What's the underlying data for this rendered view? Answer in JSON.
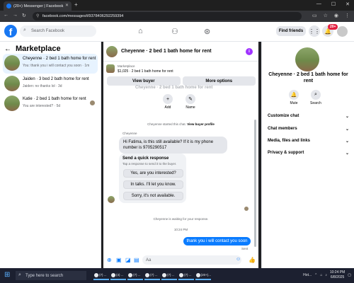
{
  "browser": {
    "tab_title": "(20+) Messenger | Facebook",
    "url": "facebook.com/messages/t/9378406292259394"
  },
  "header": {
    "search_placeholder": "Search Facebook",
    "find_friends": "Find friends",
    "notification_badge": "20+"
  },
  "left": {
    "title": "Marketplace",
    "conversations": [
      {
        "title": "Cheyenne · 2 bed 1 bath home for rent",
        "preview": "You: thank you i will contact you soon · 1m"
      },
      {
        "title": "Jaiden · 3 bed 2 bath home for rent",
        "preview": "Jaiden: no thanks lol · 3d"
      },
      {
        "title": "Katie · 2 bed 1 bath home for rent",
        "preview": "You are interested? · 5d"
      }
    ]
  },
  "chat": {
    "title": "Cheyenne · 2 bed 1 bath home for rent",
    "marketplace_label": "Marketplace",
    "listing": "$1,025 · 2 bed 1 bath home for rent",
    "view_buyer": "View buyer",
    "more_options": "More options",
    "ghost_title": "Cheyenne · 2 bed 1 bath home for rent",
    "add_label": "Add",
    "name_label": "Name",
    "started_text": "Cheyenne started this chat.",
    "view_profile": "View buyer profile",
    "sender_name": "Cheyenne",
    "incoming_message": "Hi Fatima, is this still available? If it is my phone number is 9705290517",
    "quick_header": "Send a quick response",
    "quick_sub": "Tap a response to send it to the buyer.",
    "quick_responses": [
      "Yes, are you interested?",
      "In talks. I'll let you know.",
      "Sorry, it's not available."
    ],
    "waiting_text": "Cheyenne is waiting for your response.",
    "timestamp": "10:24 PM",
    "outgoing_message": "thank you i will contact you soon",
    "sent_label": "Sent",
    "composer_placeholder": "Aa"
  },
  "right": {
    "title": "Cheyenne · 2 bed 1 bath home for rent",
    "mute": "Mute",
    "search": "Search",
    "rows": [
      "Customize chat",
      "Chat members",
      "Media, files and links",
      "Privacy & support"
    ]
  },
  "taskbar": {
    "search_placeholder": "Type here to search",
    "items": [
      "(7) ...",
      "(4) ...",
      "(7) ...",
      "(7) ...",
      "(7) ...",
      "(7) ...",
      "(20+)..."
    ],
    "tray_label": "Hot...",
    "time": "10:24 PM",
    "date": "6/8/2025"
  }
}
